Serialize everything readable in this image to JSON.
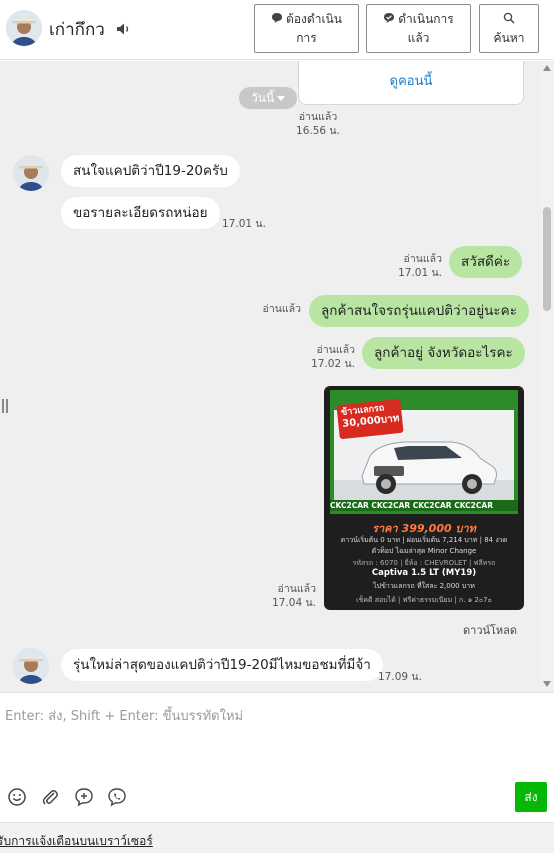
{
  "header": {
    "contact_name": "เก่ากึกว",
    "buttons": [
      {
        "line1": "ต้องดำเนิน",
        "line2": "การ"
      },
      {
        "line1": "ดำเนินการ",
        "line2": "แล้ว"
      },
      {
        "line1": "",
        "line2": "ค้นหา"
      }
    ]
  },
  "chat": {
    "coupon_link": "ดูคอนนี้",
    "date_pill": "วันนี้",
    "messages": [
      {
        "direction": "out",
        "read": "อ่านแล้ว",
        "time": "16.56 น."
      },
      {
        "direction": "in",
        "text": "สนใจแคปติว่าปี19-20ครับ"
      },
      {
        "direction": "in",
        "text": "ขอรายละเอียดรถหน่อย",
        "time": "17.01 น."
      },
      {
        "direction": "out",
        "text": "สวัสดีค่ะ",
        "read": "อ่านแล้ว",
        "time": "17.01 น."
      },
      {
        "direction": "out",
        "text": "ลูกค้าสนใจรถรุ่นแคปติว่าอยู่นะคะ",
        "read": "อ่านแล้ว"
      },
      {
        "direction": "out",
        "text": "ลูกค้าอยู่ จังหวัดอะไรคะ",
        "read": "อ่านแล้ว",
        "time": "17.02 น."
      },
      {
        "direction": "out",
        "type": "image",
        "read": "อ่านแล้ว",
        "time": "17.04 น.",
        "download": "ดาวน์โหลด"
      },
      {
        "direction": "in",
        "text": "รุ่นใหม่ล่าสุดของแคปติว่าปี19-20มีไหมขอชมที่มีจ้า",
        "time": "17.09 น."
      }
    ],
    "car_ad": {
      "badge_line1": "ข้าวแลกรถ",
      "badge_line2": "30,000บาท",
      "strip": "CKC2CAR CKC2CAR CKC2CAR CKC2CAR",
      "price": "ราคา 399,000 บาท",
      "finance": "ดาวน์เริ่มต้น 0 บาท | ผ่อนเริ่มต้น 7,214 บาท | 84 งวด",
      "option": "ตัวท็อป ไฉมล่าสุด Minor Change",
      "spec": "รหัสรถ : 6070 | ยี่ห้อ : CHEVROLET | ฟลีทรถ",
      "model": "Captiva 1.5 LT (MY19)",
      "trade": "ไปข้าวแลกรถ ที่ใสละ 2,000 บาท",
      "contact": "เช็คดี สอบได้  |  ฟรีค่าธรรมเนียม  |  ก. ๑ 2๐7๐"
    }
  },
  "composer": {
    "placeholder": "Enter: ส่ง, Shift + Enter: ขึ้นบรรทัดใหม่",
    "send_label": "ส่ง",
    "icons": [
      "emoji-icon",
      "attachment-icon",
      "add-comment-icon",
      "line-call-icon"
    ]
  },
  "footer": {
    "link": "รับการแจ้งเตือนบนเบราว์เซอร์"
  },
  "colors": {
    "chat_bg": "#efefef",
    "outgoing_bubble": "#b8e6a2",
    "incoming_bubble": "#ffffff",
    "send_button": "#06b806",
    "link": "#1d7cc7"
  }
}
